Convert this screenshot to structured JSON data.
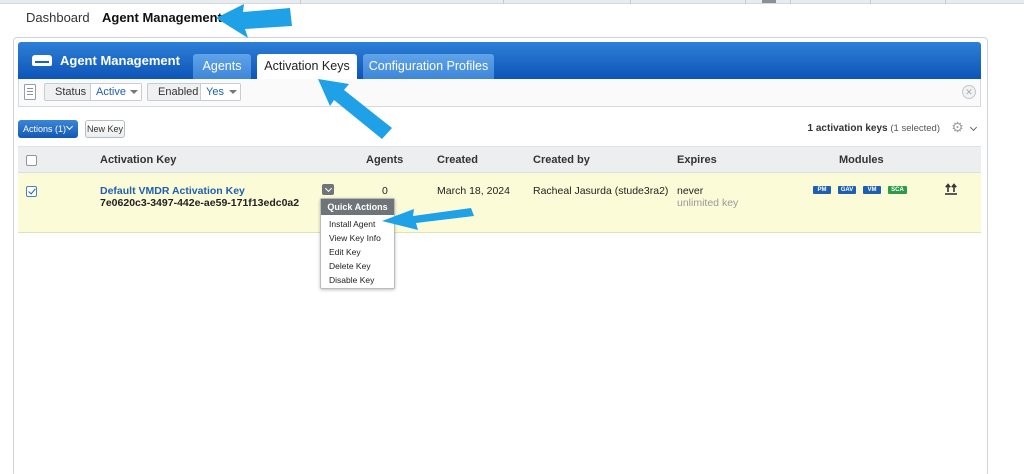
{
  "topnav": {
    "dashboard": "Dashboard",
    "agent_management": "Agent Management"
  },
  "header": {
    "title": "Agent Management",
    "tabs": [
      {
        "label": "Agents"
      },
      {
        "label": "Activation Keys",
        "active": true
      },
      {
        "label": "Configuration Profiles"
      }
    ]
  },
  "filters": [
    {
      "label": "Status",
      "value": "Active"
    },
    {
      "label": "Enabled",
      "value": "Yes"
    }
  ],
  "toolbar": {
    "actions_label": "Actions (1)",
    "new_key_label": "New Key"
  },
  "summary": {
    "count_text": "1 activation keys",
    "selected_text": "(1 selected)"
  },
  "table": {
    "columns": [
      "Activation Key",
      "Agents",
      "Created",
      "Created by",
      "Expires",
      "Modules"
    ],
    "rows": [
      {
        "checked": true,
        "name": "Default VMDR Activation Key",
        "key_id": "7e0620c3-3497-442e-ae59-171f13edc0a2",
        "agents": "0",
        "created": "March 18, 2024",
        "created_by": "Racheal Jasurda (stude3ra2)",
        "expires": "never",
        "expires_note": "unlimited key",
        "modules": [
          "PM",
          "GAV",
          "VM",
          "SCA"
        ]
      }
    ]
  },
  "quick_actions": {
    "title": "Quick Actions",
    "items": [
      "Install Agent",
      "View Key Info",
      "Edit Key",
      "Delete Key",
      "Disable Key"
    ]
  },
  "colors": {
    "header_blue": "#0d55b8",
    "row_highlight": "#fbfcd7",
    "module_badge": "#1f5fb0",
    "sca_badge": "#2f9a4b",
    "annotation_arrow": "#1ea1e6"
  },
  "icons": [
    "agent-module-icon",
    "filter-list-icon",
    "clear-filter-icon",
    "chevron-down-icon",
    "gear-icon",
    "quick-actions-toggle-icon",
    "transfer-icon",
    "annotation-arrow"
  ]
}
